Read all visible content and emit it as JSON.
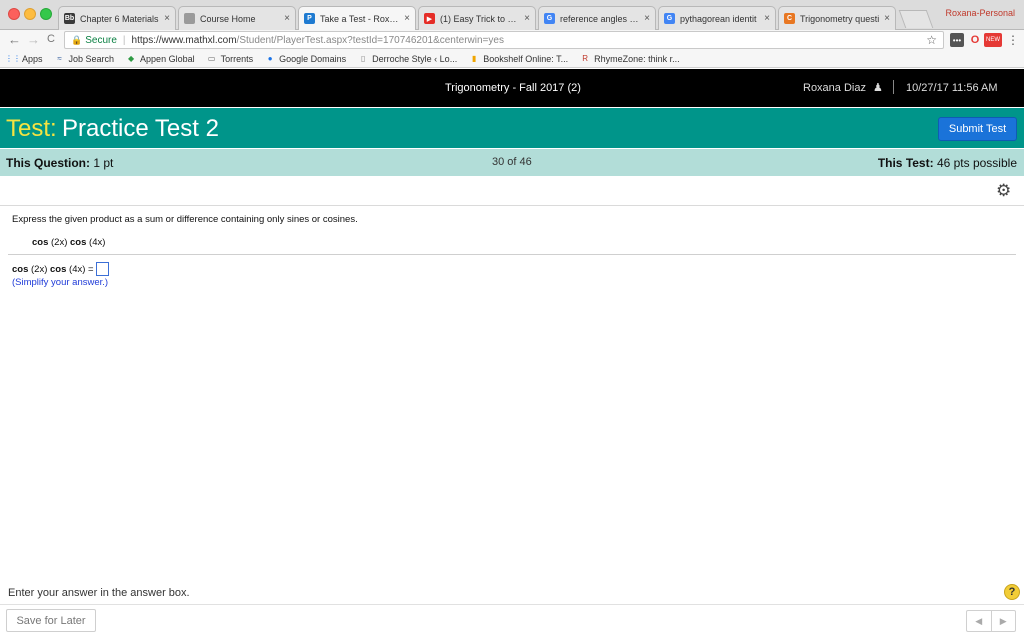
{
  "browser": {
    "tabs": [
      {
        "title": "Chapter 6 Materials",
        "favicon": "Bb",
        "fav_color": "#3a3a3a",
        "active": false
      },
      {
        "title": "Course Home",
        "favicon": "",
        "fav_color": "#9a9a9a",
        "active": false
      },
      {
        "title": "Take a Test - Roxana",
        "favicon": "P",
        "fav_color": "#1f7bd1",
        "active": true
      },
      {
        "title": "(1) Easy Trick to Find",
        "favicon": "▶",
        "fav_color": "#e52d27",
        "active": false
      },
      {
        "title": "reference angles - G",
        "favicon": "G",
        "fav_color": "#4285f4",
        "active": false
      },
      {
        "title": "pythagorean identit",
        "favicon": "G",
        "fav_color": "#4285f4",
        "active": false
      },
      {
        "title": "Trigonometry questi",
        "favicon": "C",
        "fav_color": "#e87722",
        "active": false
      }
    ],
    "tab_close": "×",
    "profile": "Roxana-Personal",
    "nav": {
      "back": "←",
      "forward": "→",
      "reload": "C"
    },
    "secure_label": "Secure",
    "url_host": "https://www.mathxl.com",
    "url_path": "/Student/PlayerTest.aspx?testId=170746201&centerwin=yes",
    "star": "☆",
    "extensions": {
      "ext1": "•••",
      "ext2": "O",
      "ext3": "NEW"
    },
    "bookmarks": [
      {
        "label": "Apps",
        "icon": "⋮⋮",
        "color": "#1a73e8"
      },
      {
        "label": "Job Search",
        "icon": "≈",
        "color": "#2b579a"
      },
      {
        "label": "Appen Global",
        "icon": "◆",
        "color": "#2e9a43"
      },
      {
        "label": "Torrents",
        "icon": "▭",
        "color": "#666666"
      },
      {
        "label": "Google Domains",
        "icon": "●",
        "color": "#1a73e8"
      },
      {
        "label": "Derroche Style ‹ Lo...",
        "icon": "▯",
        "color": "#888888"
      },
      {
        "label": "Bookshelf Online: T...",
        "icon": "▮",
        "color": "#f0a500"
      },
      {
        "label": "RhymeZone: think r...",
        "icon": "R",
        "color": "#c0392b"
      }
    ]
  },
  "course_bar": {
    "title": "Trigonometry - Fall 2017 (2)",
    "user": "Roxana Diaz",
    "user_icon": "👤",
    "datetime": "10/27/17 11:56 AM"
  },
  "test_bar": {
    "label": "Test:",
    "name": "Practice Test 2",
    "submit": "Submit Test"
  },
  "question_bar": {
    "this_question_label": "This Question:",
    "this_question_value": "1 pt",
    "progress": "30 of 46",
    "this_test_label": "This Test:",
    "this_test_value": "46 pts possible"
  },
  "question": {
    "gear": "⚙",
    "prompt": "Express the given product as a sum or difference containing only sines or cosines.",
    "expr_cos1": "cos",
    "expr_arg1": " (2x) ",
    "expr_cos2": "cos",
    "expr_arg2": " (4x)",
    "answer_cos1": "cos",
    "answer_arg1": " (2x) ",
    "answer_cos2": "cos",
    "answer_arg2": " (4x) =",
    "hint": "(Simplify your answer.)"
  },
  "footer": {
    "instruction": "Enter your answer in the answer box.",
    "help": "?",
    "save": "Save for Later",
    "prev": "◀",
    "next": "▶"
  },
  "colors": {
    "test_bar": "#00958a",
    "question_bar": "#b2ddd8",
    "submit": "#1a73d9",
    "test_label": "#f5e341"
  }
}
